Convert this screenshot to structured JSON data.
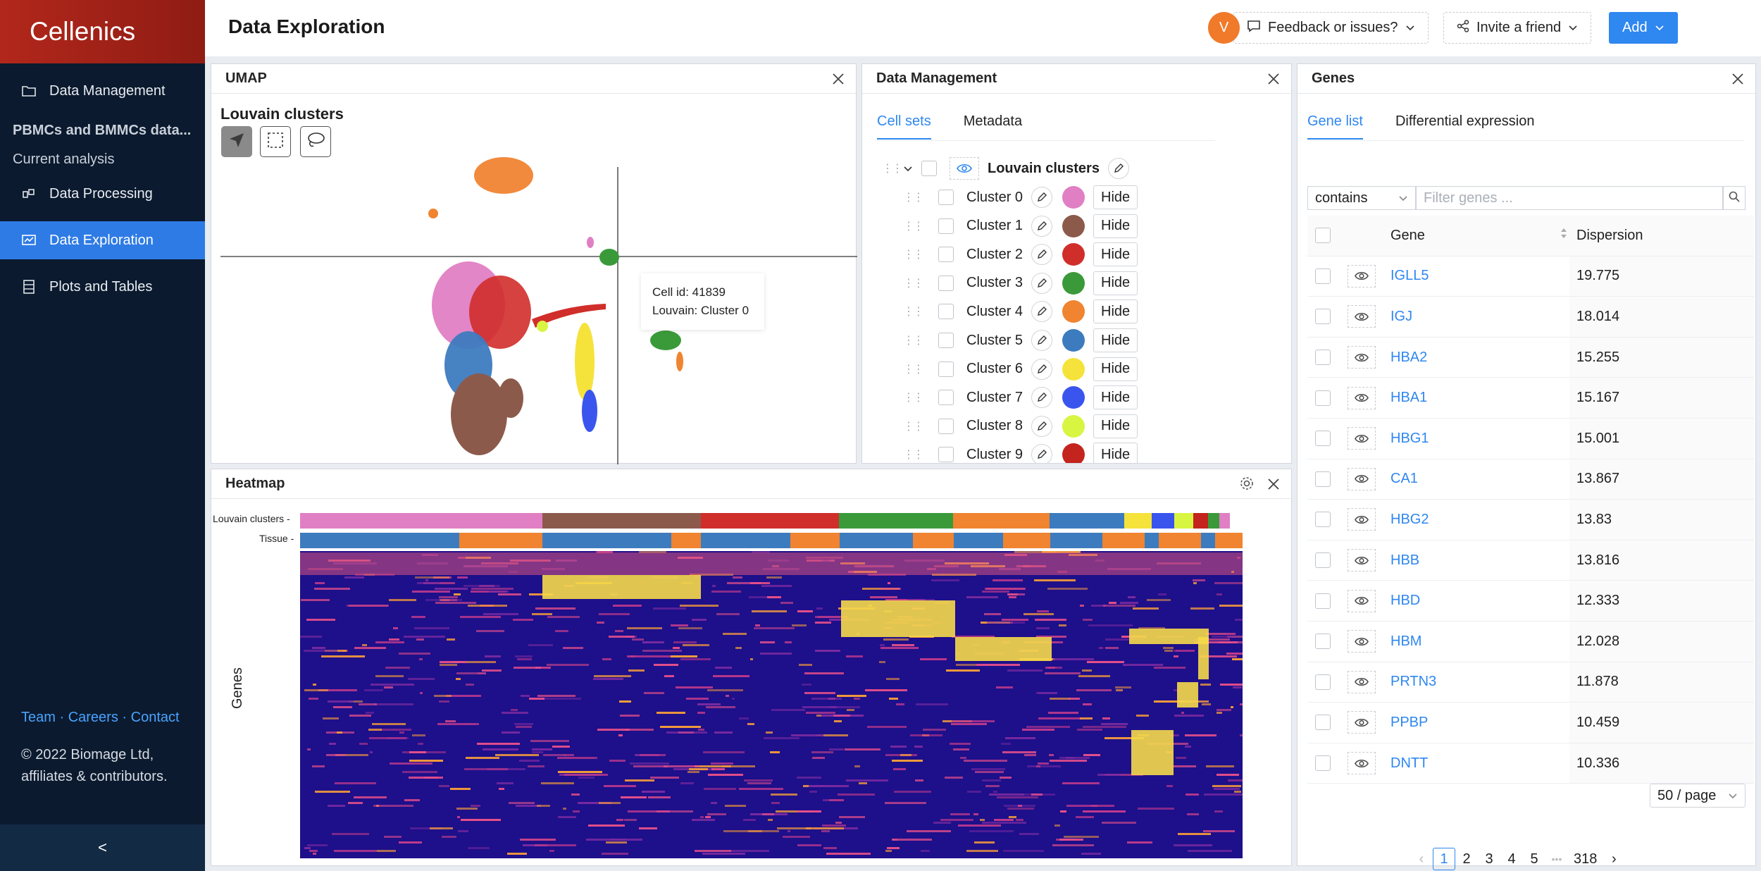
{
  "app": {
    "name": "Cellenics"
  },
  "sidebar": {
    "items": [
      {
        "label": "Data Management",
        "icon": "folder-icon"
      },
      {
        "label": "Data Processing",
        "icon": "build-icon"
      },
      {
        "label": "Data Exploration",
        "icon": "fund-icon"
      },
      {
        "label": "Plots and Tables",
        "icon": "database-icon"
      }
    ],
    "project_name": "PBMCs and BMMCs data...",
    "current_analysis": "Current analysis",
    "footer": {
      "team": "Team",
      "careers": "Careers",
      "contact": "Contact",
      "sep": "·"
    },
    "copyright": "© 2022 Biomage Ltd, affiliates & contributors.",
    "collapse": "<"
  },
  "header": {
    "title": "Data Exploration",
    "feedback": "Feedback or issues?",
    "invite": "Invite a friend",
    "add": "Add",
    "avatar": "V"
  },
  "umap": {
    "panel_title": "UMAP",
    "plot_title": "Louvain clusters",
    "tooltip": {
      "cell_id": "Cell id: 41839",
      "cluster": "Louvain: Cluster 0"
    }
  },
  "data_management": {
    "panel_title": "Data Management",
    "tabs": [
      "Cell sets",
      "Metadata"
    ],
    "group": "Louvain clusters",
    "hide_label": "Hide",
    "clusters": [
      {
        "name": "Cluster 0",
        "color": "#e07fc4"
      },
      {
        "name": "Cluster 1",
        "color": "#8c5a4b"
      },
      {
        "name": "Cluster 2",
        "color": "#d02e2a"
      },
      {
        "name": "Cluster 3",
        "color": "#3a9a3a"
      },
      {
        "name": "Cluster 4",
        "color": "#f08431"
      },
      {
        "name": "Cluster 5",
        "color": "#3d7bbf"
      },
      {
        "name": "Cluster 6",
        "color": "#f5e33c"
      },
      {
        "name": "Cluster 7",
        "color": "#3a55ee"
      },
      {
        "name": "Cluster 8",
        "color": "#d8f542"
      },
      {
        "name": "Cluster 9",
        "color": "#c3241d"
      }
    ]
  },
  "heatmap": {
    "panel_title": "Heatmap",
    "track_labels": [
      "Louvain clusters -",
      "Tissue -"
    ],
    "y_label": "Genes"
  },
  "genes": {
    "panel_title": "Genes",
    "tabs": [
      "Gene list",
      "Differential expression"
    ],
    "filter_mode": "contains",
    "filter_placeholder": "Filter genes ...",
    "columns": [
      "Gene",
      "Dispersion"
    ],
    "rows": [
      {
        "gene": "IGLL5",
        "dispersion": "19.775"
      },
      {
        "gene": "IGJ",
        "dispersion": "18.014"
      },
      {
        "gene": "HBA2",
        "dispersion": "15.255"
      },
      {
        "gene": "HBA1",
        "dispersion": "15.167"
      },
      {
        "gene": "HBG1",
        "dispersion": "15.001"
      },
      {
        "gene": "CA1",
        "dispersion": "13.867"
      },
      {
        "gene": "HBG2",
        "dispersion": "13.83"
      },
      {
        "gene": "HBB",
        "dispersion": "13.816"
      },
      {
        "gene": "HBD",
        "dispersion": "12.333"
      },
      {
        "gene": "HBM",
        "dispersion": "12.028"
      },
      {
        "gene": "PRTN3",
        "dispersion": "11.878"
      },
      {
        "gene": "PPBP",
        "dispersion": "10.459"
      },
      {
        "gene": "DNTT",
        "dispersion": "10.336"
      }
    ],
    "pagination": {
      "pages": [
        "1",
        "2",
        "3",
        "4",
        "5"
      ],
      "ellipsis": "•••",
      "last": "318",
      "page_size": "50 / page"
    }
  }
}
